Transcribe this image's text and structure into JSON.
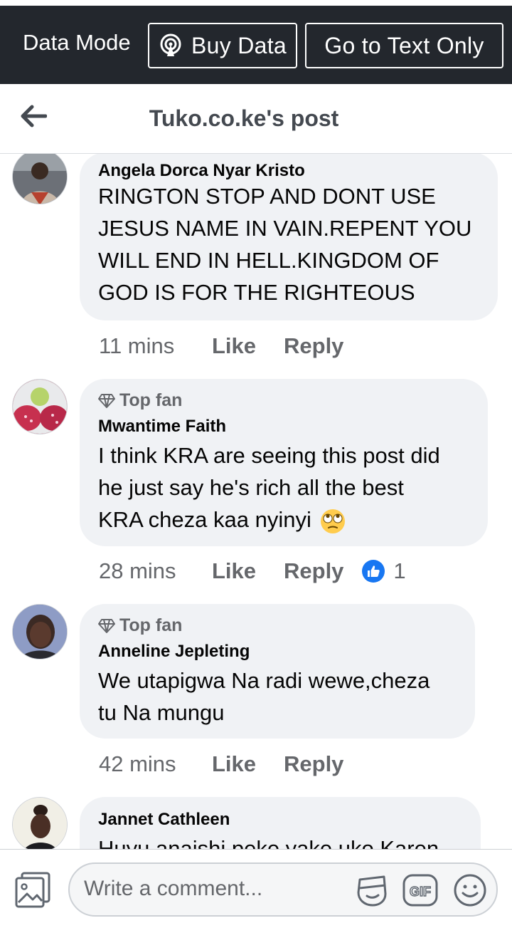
{
  "data_bar": {
    "mode_label": "Data Mode",
    "buy_label": "Buy Data",
    "text_only_label": "Go to Text Only",
    "background": "#23272d"
  },
  "header": {
    "title": "Tuko.co.ke's post"
  },
  "comments": [
    {
      "author": "Angela Dorca Nyar Kristo",
      "top_fan": false,
      "text_lines": [
        "RINGTON STOP AND DONT USE",
        "JESUS NAME IN VAIN.REPENT YOU",
        "WILL END IN HELL.KINGDOM OF",
        "GOD IS FOR THE RIGHTEOUS"
      ],
      "time": "11 mins",
      "like": "Like",
      "reply": "Reply"
    },
    {
      "author": "Mwantime Faith",
      "top_fan": true,
      "badge": "Top fan",
      "text_lines": [
        "I think KRA are seeing this post did",
        "he just say he's rich all the best",
        "KRA cheza kaa nyinyi"
      ],
      "emoji": "eye-roll-emoji",
      "time": "28 mins",
      "like": "Like",
      "reply": "Reply",
      "reaction_count": "1"
    },
    {
      "author": "Anneline Jepleting",
      "top_fan": true,
      "badge": "Top fan",
      "text_lines": [
        "We utapigwa Na radi wewe,cheza",
        "tu Na mungu"
      ],
      "time": "42 mins",
      "like": "Like",
      "reply": "Reply"
    },
    {
      "author": "Jannet Cathleen",
      "top_fan": false,
      "text_lines": [
        "Huyu anaishi peke yake uko Karen"
      ]
    }
  ],
  "composer": {
    "placeholder": "Write a comment...",
    "icons": [
      "photo-icon",
      "sticker-icon",
      "gif-icon",
      "emoji-icon"
    ]
  },
  "colors": {
    "bubble": "#f0f2f5",
    "secondary_text": "#65676b",
    "like_blue": "#1877f2"
  }
}
